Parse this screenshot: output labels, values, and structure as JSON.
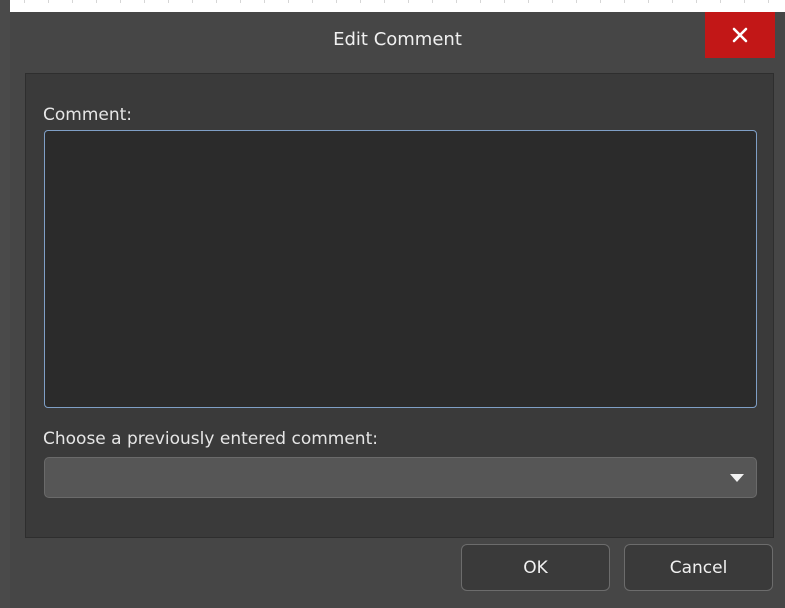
{
  "dialog": {
    "title": "Edit Comment",
    "close_label": "✕"
  },
  "comment": {
    "label": "Comment:",
    "value": ""
  },
  "history": {
    "label": "Choose a previously entered comment:",
    "selected": ""
  },
  "buttons": {
    "ok": "OK",
    "cancel": "Cancel"
  },
  "colors": {
    "close_button": "#c21717",
    "textarea_focus_border": "#7f9fc6"
  },
  "icons": {
    "close": "close-icon",
    "dropdown": "chevron-down-icon"
  }
}
